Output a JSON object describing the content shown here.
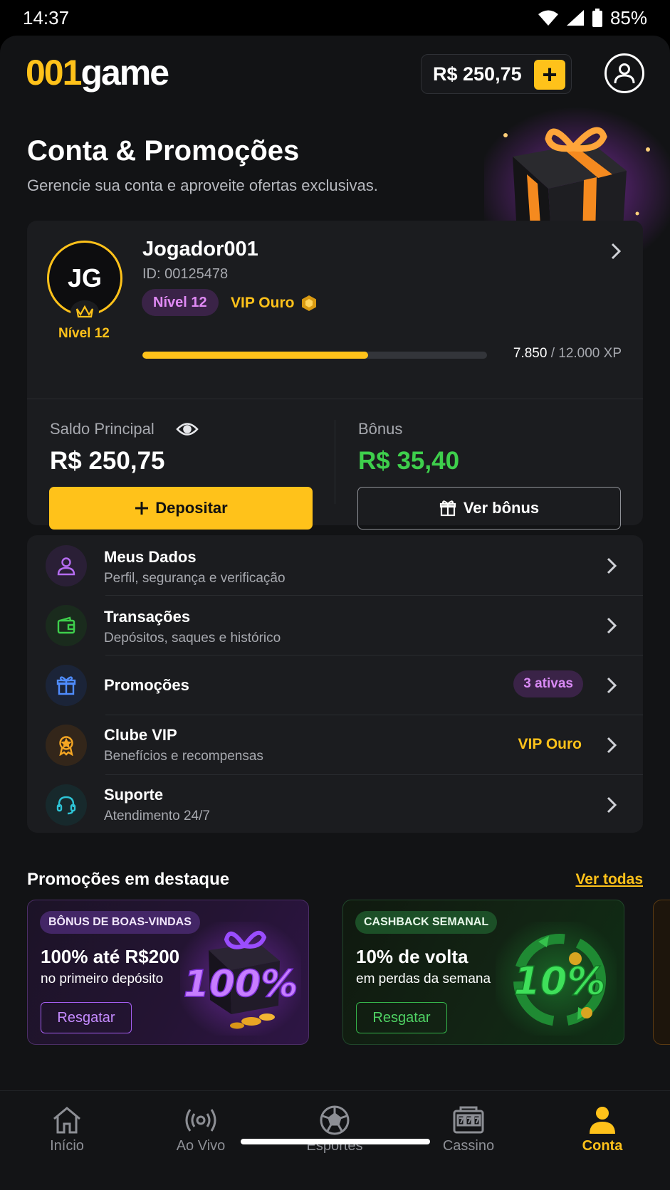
{
  "status_bar": {
    "time": "14:37",
    "battery": "85%"
  },
  "header": {
    "logo_part1": "001",
    "logo_part2": "game",
    "balance": "R$ 250,75",
    "add_funds_symbol": "+"
  },
  "hero": {
    "title": "Conta & Promoções",
    "subtitle": "Gerencie sua conta e aproveite ofertas exclusivas."
  },
  "account": {
    "initials": "JG",
    "level_under_avatar": "Nível 12",
    "username": "Jogador001",
    "user_id": "ID: 00125478",
    "level_badge": "Nível 12",
    "vip_tier": "VIP Ouro",
    "xp_current": "7.850",
    "xp_total": "/ 12.000 XP",
    "xp_progress": 0.654,
    "main_balance_label": "Saldo Principal",
    "main_balance_value": "R$ 250,75",
    "bonus_label": "Bônus",
    "bonus_value": "R$ 35,40",
    "deposit_button": "Depositar",
    "view_bonus_button": "Ver bônus"
  },
  "menu": [
    {
      "title": "Meus Dados",
      "subtitle": "Perfil, segurança e verificação",
      "icon": "user-icon",
      "color": "#b56cf0"
    },
    {
      "title": "Transações",
      "subtitle": "Depósitos, saques e histórico",
      "icon": "wallet-icon",
      "color": "#3ecf4c"
    },
    {
      "title": "Promoções",
      "subtitle": "",
      "badge": "3 ativas",
      "icon": "gift-icon",
      "color": "#4f8cff"
    },
    {
      "title": "Clube VIP",
      "subtitle": "Benefícios e recompensas",
      "value": "VIP Ouro",
      "icon": "medal-icon",
      "color": "#f5a623"
    },
    {
      "title": "Suporte",
      "subtitle": "Atendimento 24/7",
      "icon": "headset-icon",
      "color": "#2ec4d6"
    }
  ],
  "promos": {
    "heading": "Promoções em destaque",
    "see_all": "Ver todas",
    "cards": [
      {
        "badge": "BÔNUS DE BOAS-VINDAS",
        "title": "100% até R$200",
        "subtitle": "no primeiro depósito",
        "button": "Resgatar",
        "art_text": "100%"
      },
      {
        "badge": "CASHBACK SEMANAL",
        "title": "10% de volta",
        "subtitle": "em perdas da semana",
        "button": "Resgatar",
        "art_text": "10%"
      }
    ]
  },
  "bottom_nav": [
    {
      "label": "Início",
      "icon": "home-icon"
    },
    {
      "label": "Ao Vivo",
      "icon": "live-broadcast-icon"
    },
    {
      "label": "Esportes",
      "icon": "soccer-ball-icon"
    },
    {
      "label": "Cassino",
      "icon": "slot-machine-icon"
    },
    {
      "label": "Conta",
      "icon": "account-icon",
      "active": true
    }
  ],
  "colors": {
    "accent": "#ffc21a",
    "background": "#121315",
    "card": "#1b1c1f",
    "bonus_green": "#3ecf4c",
    "purple": "#b56cf0"
  }
}
